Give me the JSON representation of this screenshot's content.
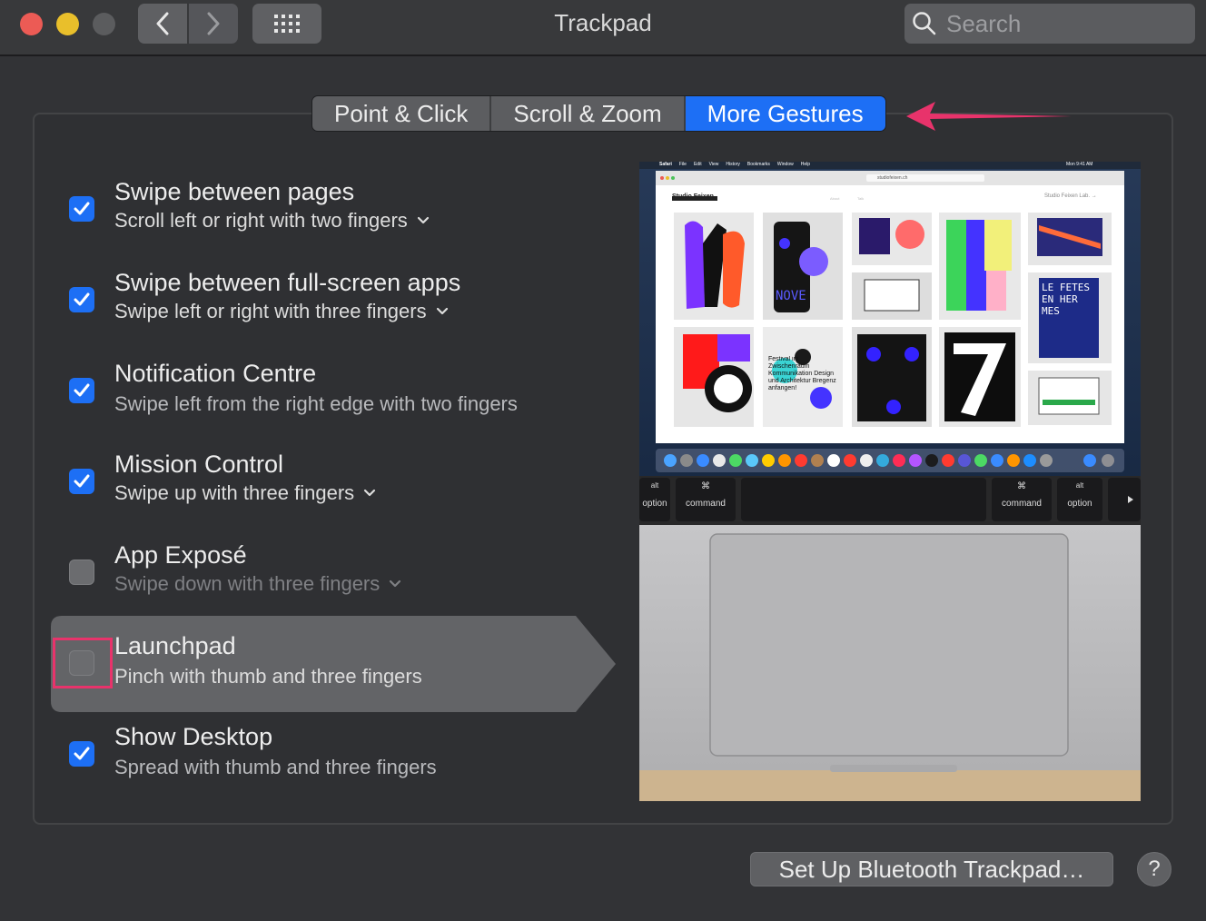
{
  "window": {
    "title": "Trackpad",
    "search_placeholder": "Search"
  },
  "icons": {
    "back": "chevron-left-icon",
    "forward": "chevron-right-icon",
    "show_all": "grid-icon",
    "search": "search-icon"
  },
  "tabs": [
    {
      "label": "Point & Click",
      "active": false
    },
    {
      "label": "Scroll & Zoom",
      "active": false
    },
    {
      "label": "More Gestures",
      "active": true
    }
  ],
  "options": [
    {
      "title": "Swipe between pages",
      "subtitle": "Scroll left or right with two fingers",
      "checked": true,
      "has_menu": true
    },
    {
      "title": "Swipe between full-screen apps",
      "subtitle": "Swipe left or right with three fingers",
      "checked": true,
      "has_menu": true
    },
    {
      "title": "Notification Centre",
      "subtitle": "Swipe left from the right edge with two fingers",
      "checked": true,
      "has_menu": false
    },
    {
      "title": "Mission Control",
      "subtitle": "Swipe up with three fingers",
      "checked": true,
      "has_menu": true
    },
    {
      "title": "App Exposé",
      "subtitle": "Swipe down with three fingers",
      "checked": false,
      "has_menu": true
    },
    {
      "title": "Launchpad",
      "subtitle": "Pinch with thumb and three fingers",
      "checked": false,
      "has_menu": false,
      "highlighted": true
    },
    {
      "title": "Show Desktop",
      "subtitle": "Spread with thumb and three fingers",
      "checked": true,
      "has_menu": false
    }
  ],
  "preview": {
    "menubar": [
      "Safari",
      "File",
      "Edit",
      "View",
      "History",
      "Bookmarks",
      "Window",
      "Help"
    ],
    "clock": "Mon 9:41 AM",
    "url": "studiofeixen.ch",
    "site_name": "Studio Feixen",
    "site_link": "Studio Feixen Lab. →",
    "nav_links": [
      "About",
      "Talk"
    ],
    "keys": [
      {
        "top": "alt",
        "bottom": "option"
      },
      {
        "top": "⌘",
        "bottom": "command"
      },
      {
        "top": "⌘",
        "bottom": "command"
      },
      {
        "top": "alt",
        "bottom": "option"
      }
    ],
    "poster_text_1": "NOVE",
    "poster_text_2": "LE FETES EN HER MES",
    "poster_text_3": "Festival im Zwischenraum Kommunikation Design und Architektur Bregenz anfangen!"
  },
  "buttons": {
    "bluetooth": "Set Up Bluetooth Trackpad…",
    "help": "?"
  },
  "colors": {
    "accent": "#1d6ff5",
    "annotation": "#e8336b",
    "background": "#323336"
  }
}
